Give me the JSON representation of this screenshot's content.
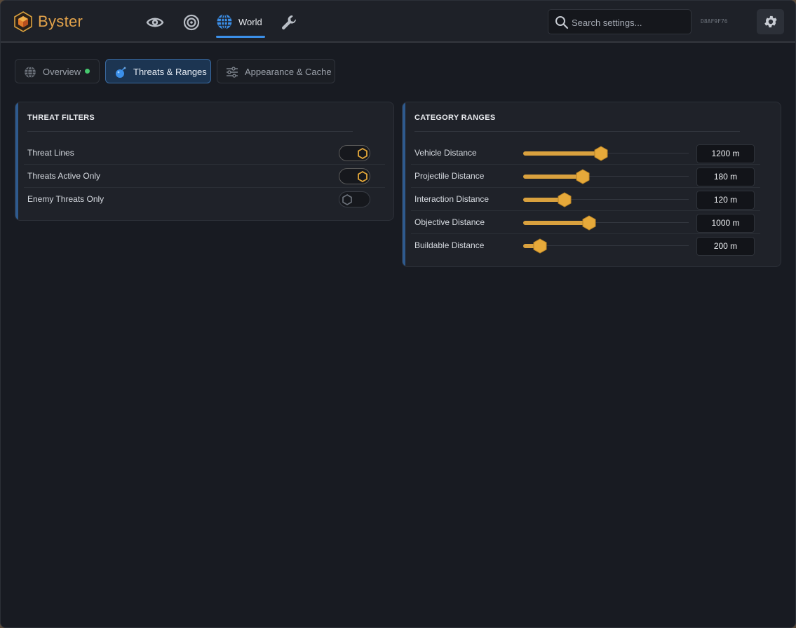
{
  "app": {
    "brand": "Byster",
    "session_id": "D8AF9F76"
  },
  "nav": {
    "items": [
      {
        "name": "visuals",
        "icon": "eye-icon"
      },
      {
        "name": "aim",
        "icon": "target-icon"
      },
      {
        "name": "world",
        "icon": "globe-icon",
        "label": "World",
        "active": true
      },
      {
        "name": "tools",
        "icon": "wrench-icon"
      }
    ]
  },
  "search": {
    "placeholder": "Search settings..."
  },
  "tabs": [
    {
      "label": "Overview",
      "icon": "globe-icon",
      "status": "online"
    },
    {
      "label": "Threats & Ranges",
      "icon": "bomb-icon",
      "active": true
    },
    {
      "label": "Appearance & Cache",
      "icon": "sliders-icon"
    }
  ],
  "threat_filters": {
    "title": "THREAT FILTERS",
    "rows": [
      {
        "label": "Threat Lines",
        "enabled": true
      },
      {
        "label": "Threats Active Only",
        "enabled": true
      },
      {
        "label": "Enemy Threats Only",
        "enabled": false
      }
    ]
  },
  "category_ranges": {
    "title": "CATEGORY RANGES",
    "rows": [
      {
        "label": "Vehicle Distance",
        "value": "1200 m",
        "fraction": 0.47
      },
      {
        "label": "Projectile Distance",
        "value": "180 m",
        "fraction": 0.36
      },
      {
        "label": "Interaction Distance",
        "value": "120 m",
        "fraction": 0.25
      },
      {
        "label": "Objective Distance",
        "value": "1000 m",
        "fraction": 0.4
      },
      {
        "label": "Buildable Distance",
        "value": "200 m",
        "fraction": 0.1
      }
    ]
  },
  "colors": {
    "accent": "#d9a13e",
    "active_tab": "#1c3552",
    "link_blue": "#3b8fe8",
    "status_green": "#46c86e",
    "background": "#181b22"
  }
}
